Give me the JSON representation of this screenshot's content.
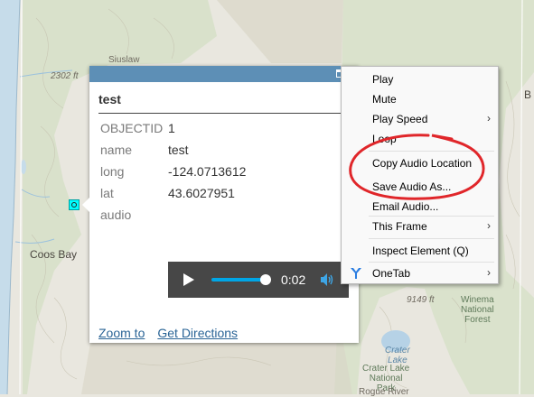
{
  "map": {
    "labels": {
      "siuslaw": "Siuslaw",
      "elev_2302": "2302 ft",
      "coos_bay": "Coos Bay",
      "elev_9149": "9149 ft",
      "winema": "Winema\nNational\nForest",
      "crater_lake_water": "Crater\nLake",
      "crater_lake_park": "Crater Lake\nNational\nPark",
      "rogue": "Rogue River",
      "edge_b": "B"
    },
    "colors": {
      "land": "#e9e7df",
      "ocean": "#c6dcea",
      "forest": "#d4e0c6",
      "terrain": "#d9d6c6"
    }
  },
  "popup": {
    "title": "test",
    "fields": [
      {
        "key": "OBJECTID",
        "value": "1"
      },
      {
        "key": "name",
        "value": "test"
      },
      {
        "key": "long",
        "value": "-124.0713612"
      },
      {
        "key": "lat",
        "value": "43.6027951"
      },
      {
        "key": "audio",
        "value": ""
      }
    ],
    "audio": {
      "time": "0:02",
      "progress": 0.88
    },
    "links": {
      "zoom_to": "Zoom to",
      "get_directions": "Get Directions"
    },
    "colors": {
      "titlebar": "#5d8fb6",
      "link": "#2a6496"
    }
  },
  "context_menu": {
    "items": [
      {
        "label": "Play",
        "submenu": false
      },
      {
        "label": "Mute",
        "submenu": false
      },
      {
        "label": "Play Speed",
        "submenu": true
      },
      {
        "label": "Loop",
        "submenu": false
      },
      {
        "label": "Copy Audio Location",
        "submenu": false
      },
      {
        "label": "Save Audio As...",
        "submenu": false
      },
      {
        "label": "Email Audio...",
        "submenu": false
      },
      {
        "label": "This Frame",
        "submenu": true
      },
      {
        "label": "Inspect Element (Q)",
        "submenu": false
      },
      {
        "label": "OneTab",
        "submenu": true,
        "icon": "onetab-icon"
      }
    ],
    "annotation_color": "#e0262a"
  }
}
